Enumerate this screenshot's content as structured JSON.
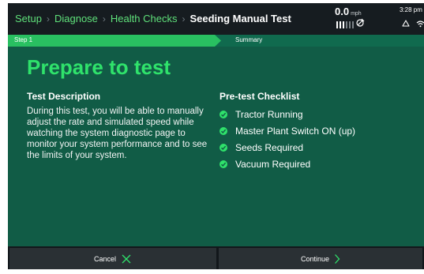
{
  "header": {
    "breadcrumbs": [
      "Setup",
      "Diagnose",
      "Health Checks"
    ],
    "current_page": "Seeding Manual Test",
    "speed_value": "0.0",
    "speed_unit": "mph",
    "time": "3:28 pm",
    "status_icons": [
      "signal-bars-icon",
      "satellite-icon",
      "cloud-icon",
      "wifi-icon"
    ]
  },
  "steps": [
    {
      "label": "Step 1",
      "active": true
    },
    {
      "label": "Summary",
      "active": false
    }
  ],
  "main": {
    "title": "Prepare to test",
    "description": {
      "heading": "Test Description",
      "text": "During this test, you will be able to manually adjust the rate and simulated speed while watching the system diagnostic page to monitor your system performance and to see the limits of your system."
    },
    "checklist": {
      "heading": "Pre-test Checklist",
      "items": [
        "Tractor Running",
        "Master Plant Switch ON (up)",
        "Seeds Required",
        "Vacuum Required"
      ]
    }
  },
  "footer": {
    "cancel_label": "Cancel",
    "continue_label": "Continue"
  },
  "colors": {
    "accent_green": "#2fe26b",
    "panel_green": "#115c46",
    "step_active": "#29c061",
    "step_inactive": "#106a4e",
    "header_bg": "#161c20",
    "button_bg": "#2a3034"
  }
}
